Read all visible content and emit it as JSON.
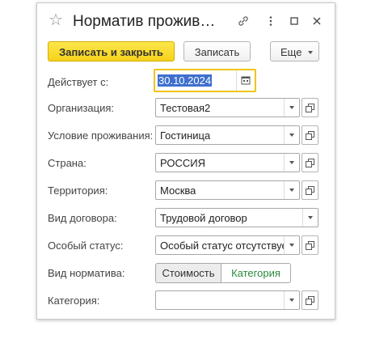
{
  "window": {
    "title": "Норматив прожив…"
  },
  "toolbar": {
    "save_close_label": "Записать и закрыть",
    "save_label": "Записать",
    "more_label": "Еще"
  },
  "fields": {
    "effective_date": {
      "label": "Действует с:",
      "value": "30.10.2024"
    },
    "organization": {
      "label": "Организация:",
      "value": "Тестовая2"
    },
    "accommodation": {
      "label": "Условие проживания:",
      "value": "Гостиница"
    },
    "country": {
      "label": "Страна:",
      "value": "РОССИЯ"
    },
    "territory": {
      "label": "Территория:",
      "value": "Москва"
    },
    "contract_type": {
      "label": "Вид договора:",
      "value": "Трудовой договор"
    },
    "special_status": {
      "label": "Особый статус:",
      "value": "Особый статус отсутствует"
    },
    "norm_type": {
      "label": "Вид норматива:",
      "options": [
        "Стоимость",
        "Категория"
      ],
      "selected": "Стоимость"
    },
    "category": {
      "label": "Категория:",
      "value": ""
    }
  },
  "colors": {
    "primary_button": "#f6d21b",
    "date_focus_border": "#f0c419",
    "date_selection": "#3e6fce",
    "link_green": "#2b8a3e"
  },
  "icons": [
    "star-icon",
    "link-icon",
    "more-vertical-icon",
    "maximize-icon",
    "close-icon",
    "calendar-icon",
    "chevron-down-icon",
    "open-icon"
  ]
}
